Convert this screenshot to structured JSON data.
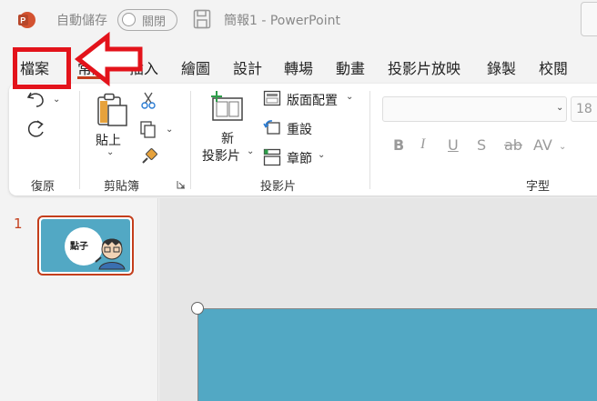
{
  "titlebar": {
    "autosave_label": "自動儲存",
    "toggle_label": "關閉",
    "doc_title": "簡報1  -  PowerPoint"
  },
  "tabs": [
    {
      "label": "檔案"
    },
    {
      "label": "常用"
    },
    {
      "label": "插入"
    },
    {
      "label": "繪圖"
    },
    {
      "label": "設計"
    },
    {
      "label": "轉場"
    },
    {
      "label": "動畫"
    },
    {
      "label": "投影片放映"
    },
    {
      "label": "錄製"
    },
    {
      "label": "校閱"
    }
  ],
  "ribbon": {
    "undo_group_label": "復原",
    "clipboard": {
      "paste_label": "貼上",
      "group_label": "剪貼簿"
    },
    "slides": {
      "new_slide_label_1": "新",
      "new_slide_label_2": "投影片",
      "layout_label": "版面配置",
      "reset_label": "重設",
      "section_label": "章節",
      "group_label": "投影片"
    },
    "font": {
      "size_value": "18",
      "group_label": "字型",
      "buttons": [
        "B",
        "I",
        "U",
        "S",
        "ab",
        "AV"
      ]
    }
  },
  "slides_panel": {
    "slide_number": "1"
  },
  "thumbnail": {
    "logo_text": "點子"
  },
  "colors": {
    "accent": "#c43e1c",
    "slide_bg": "#52a8c4",
    "highlight": "#e3131b"
  }
}
